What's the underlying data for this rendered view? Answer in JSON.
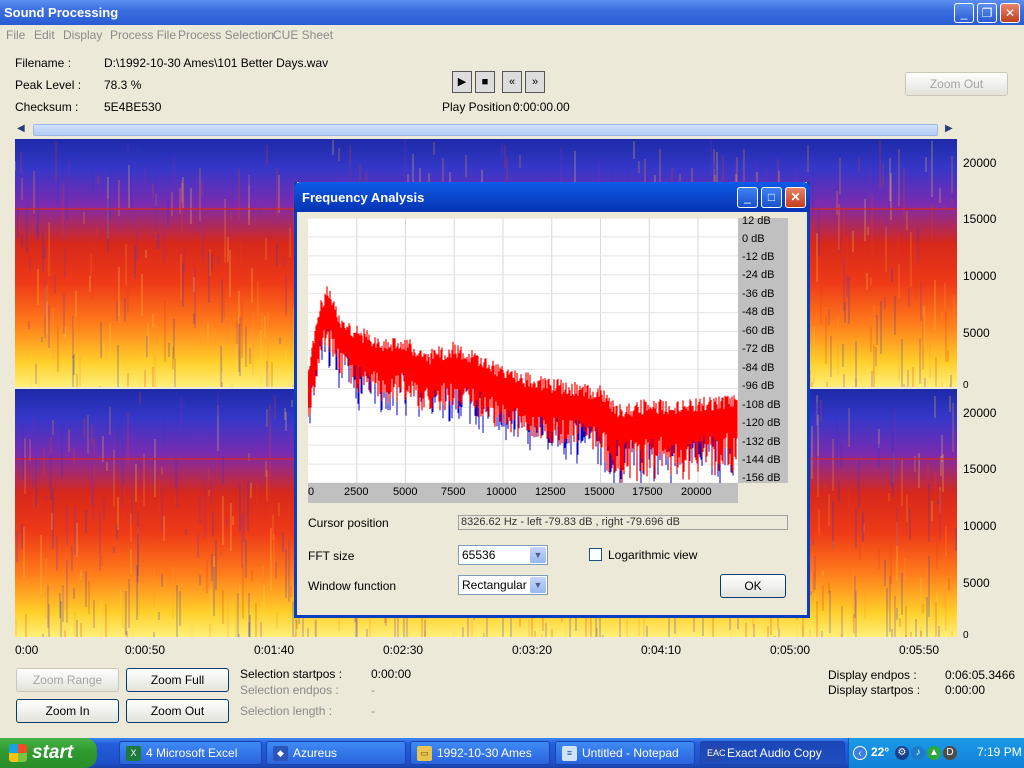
{
  "window": {
    "title": "Sound Processing"
  },
  "menu": [
    "File",
    "Edit",
    "Display",
    "Process File",
    "Process Selection",
    "CUE Sheet"
  ],
  "info": {
    "filename_label": "Filename :",
    "filename": "D:\\1992-10-30 Ames\\101 Better Days.wav",
    "peak_label": "Peak Level :",
    "peak": "78.3 %",
    "checksum_label": "Checksum :",
    "checksum": "5E4BE530",
    "play_position_label": "Play Position :",
    "play_position": "0:00:00.00"
  },
  "zoom_out_top": "Zoom Out",
  "freq_axis": [
    "20000",
    "15000",
    "10000",
    "5000",
    "0"
  ],
  "time_axis": [
    "0:00",
    "0:00:50",
    "0:01:40",
    "0:02:30",
    "0:03:20",
    "0:04:10",
    "0:05:00",
    "0:05:50"
  ],
  "bottom": {
    "zoom_range": "Zoom Range",
    "zoom_full": "Zoom Full",
    "zoom_in": "Zoom In",
    "zoom_out": "Zoom Out",
    "sel_start_label": "Selection startpos :",
    "sel_start": "0:00:00",
    "sel_end_label": "Selection endpos :",
    "sel_end": "-",
    "sel_len_label": "Selection length :",
    "sel_len": "-",
    "disp_end_label": "Display endpos :",
    "disp_end": "0:06:05.3466",
    "disp_start_label": "Display startpos :",
    "disp_start": "0:00:00"
  },
  "dialog": {
    "title": "Frequency Analysis",
    "db_labels": [
      "12 dB",
      "0 dB",
      "-12 dB",
      "-24 dB",
      "-36 dB",
      "-48 dB",
      "-60 dB",
      "-72 dB",
      "-84 dB",
      "-96 dB",
      "-108 dB",
      "-120 dB",
      "-132 dB",
      "-144 dB",
      "-156 dB"
    ],
    "x_labels": [
      "0",
      "2500",
      "5000",
      "7500",
      "10000",
      "12500",
      "15000",
      "17500",
      "20000"
    ],
    "cursor_label": "Cursor position",
    "cursor_value": "8326.62 Hz  -  left -79.83 dB , right -79.696 dB",
    "fft_label": "FFT size",
    "fft_value": "65536",
    "log_label": "Logarithmic view",
    "window_label": "Window function",
    "window_value": "Rectangular",
    "ok": "OK"
  },
  "chart_data": {
    "type": "area",
    "title": "",
    "xlabel": "",
    "ylabel": "",
    "xlim": [
      0,
      22050
    ],
    "ylim": [
      -156,
      12
    ],
    "colors": {
      "left": "#ff0000",
      "right": "#0000cc"
    },
    "x": [
      0,
      500,
      1000,
      1500,
      2500,
      4000,
      5000,
      6000,
      7500,
      9000,
      10000,
      12000,
      14000,
      15000,
      16000,
      17500,
      19000,
      20000,
      21000,
      22050
    ],
    "series": [
      {
        "values": [
          -96,
          -60,
          -45,
          -62,
          -72,
          -80,
          -78,
          -88,
          -82,
          -90,
          -98,
          -104,
          -108,
          -110,
          -122,
          -118,
          -120,
          -118,
          -116,
          -114
        ]
      }
    ]
  },
  "taskbar": {
    "start": "start",
    "tasks": [
      "4 Microsoft Excel",
      "Azureus",
      "1992-10-30 Ames",
      "Untitled - Notepad",
      "Exact Audio Copy"
    ],
    "temp": "22°",
    "clock": "7:19 PM"
  }
}
